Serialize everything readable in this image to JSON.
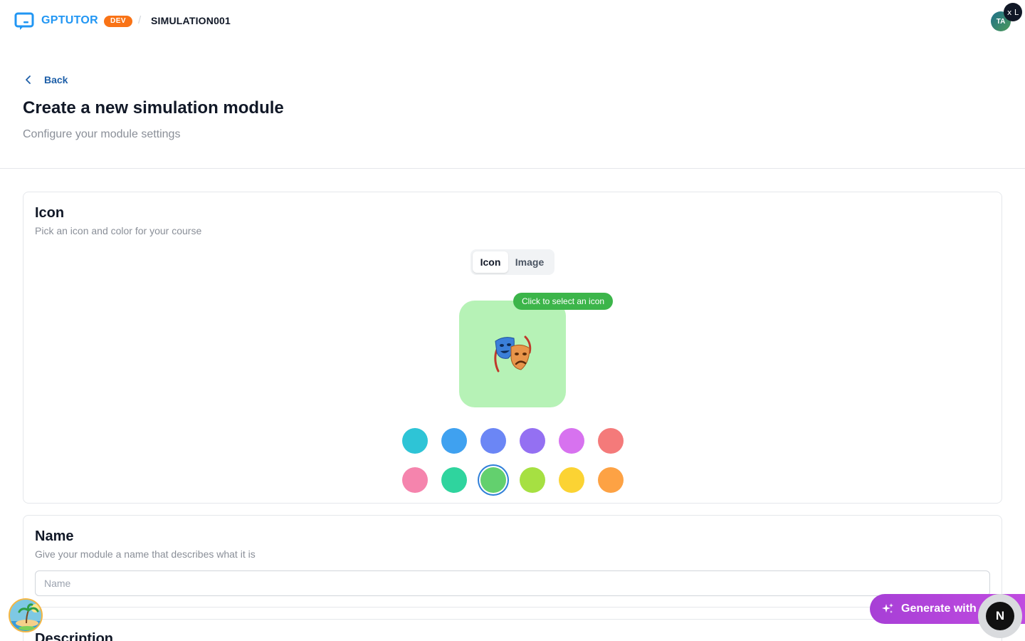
{
  "header": {
    "brand": "GPTUTOR",
    "env_badge": "DEV",
    "breadcrumb_separator": "/",
    "breadcrumb_current": "SIMULATION001",
    "avatar_initials": "TA",
    "avatar_badge": "x L"
  },
  "page": {
    "back_label": "Back",
    "title": "Create a new simulation module",
    "subtitle": "Configure your module settings"
  },
  "icon_section": {
    "title": "Icon",
    "subtitle": "Pick an icon and color for your course",
    "tabs": [
      {
        "label": "Icon",
        "active": true
      },
      {
        "label": "Image",
        "active": false
      }
    ],
    "tooltip": "Click to select an icon",
    "selected_icon": "🎭",
    "selected_icon_name": "performing-arts-icon",
    "preview_color": "#b6f2b6",
    "colors": [
      {
        "hex": "#2ec4d6",
        "selected": false
      },
      {
        "hex": "#3fa1f0",
        "selected": false
      },
      {
        "hex": "#6b86f5",
        "selected": false
      },
      {
        "hex": "#9470f2",
        "selected": false
      },
      {
        "hex": "#d772ef",
        "selected": false
      },
      {
        "hex": "#f47a7a",
        "selected": false
      },
      {
        "hex": "#f584ad",
        "selected": false
      },
      {
        "hex": "#2fd49e",
        "selected": false
      },
      {
        "hex": "#63d06e",
        "selected": true
      },
      {
        "hex": "#a6e042",
        "selected": false
      },
      {
        "hex": "#fbd333",
        "selected": false
      },
      {
        "hex": "#fda244",
        "selected": false
      }
    ]
  },
  "name_section": {
    "title": "Name",
    "subtitle": "Give your module a name that describes what it is",
    "input_value": "",
    "input_placeholder": "Name"
  },
  "description_section": {
    "title": "Description"
  },
  "floating": {
    "generate_label": "Generate with",
    "next_label": "N",
    "accent": "#b444dc"
  }
}
